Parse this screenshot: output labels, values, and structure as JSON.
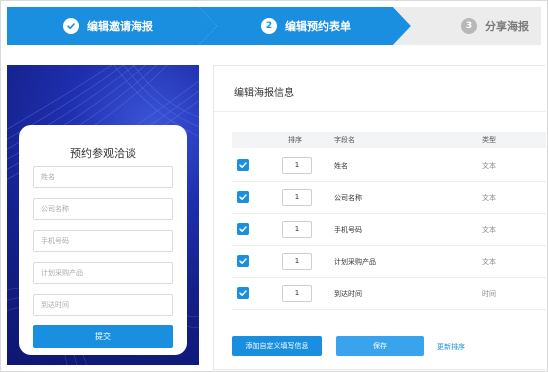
{
  "steps": [
    {
      "label": "编辑邀请海报",
      "number": "",
      "state": "done",
      "icon": "check-icon"
    },
    {
      "label": "编辑预约表单",
      "number": "2",
      "state": "active"
    },
    {
      "label": "分享海报",
      "number": "3",
      "state": "pending"
    }
  ],
  "poster": {
    "form_title": "预约参观洽谈",
    "fields": [
      "姓名",
      "公司名称",
      "手机号码",
      "计划采购产品",
      "到达时间"
    ],
    "submit_label": "提交"
  },
  "panel": {
    "title": "编辑海报信息",
    "columns": {
      "order": "排序",
      "field_name": "字段名",
      "type": "类型"
    },
    "rows": [
      {
        "checked": true,
        "order": "1",
        "field_name": "姓名",
        "type": "文本"
      },
      {
        "checked": true,
        "order": "1",
        "field_name": "公司名称",
        "type": "文本"
      },
      {
        "checked": true,
        "order": "1",
        "field_name": "手机号码",
        "type": "文本"
      },
      {
        "checked": true,
        "order": "1",
        "field_name": "计划采购产品",
        "type": "文本"
      },
      {
        "checked": true,
        "order": "1",
        "field_name": "到达时间",
        "type": "时间"
      }
    ],
    "add_custom_label": "添加自定义填写信息",
    "save_label": "保存",
    "update_sort_label": "更新排序"
  },
  "colors": {
    "accent": "#1a8fe0",
    "poster_bg": "#14218a",
    "pending_step": "#ececec"
  }
}
